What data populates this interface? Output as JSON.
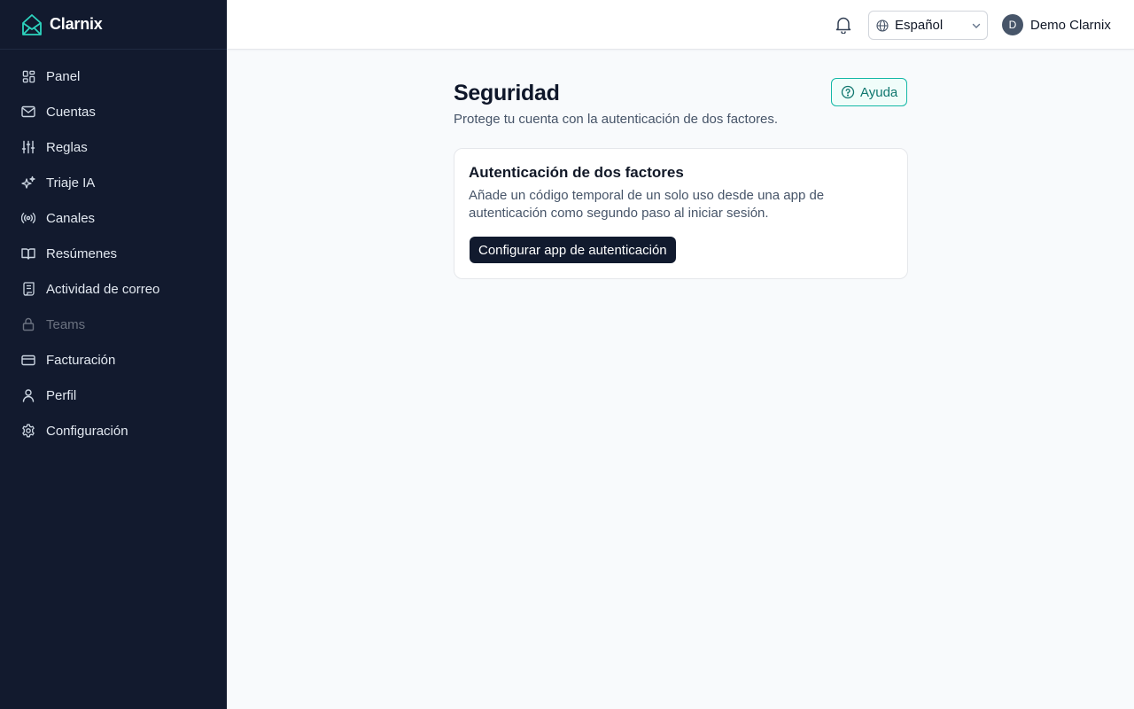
{
  "app": {
    "name": "Clarnix",
    "accent": "#14b8a6"
  },
  "sidebar": {
    "items": [
      {
        "label": "Panel",
        "icon": "dashboard-icon"
      },
      {
        "label": "Cuentas",
        "icon": "mail-icon"
      },
      {
        "label": "Reglas",
        "icon": "sliders-icon"
      },
      {
        "label": "Triaje IA",
        "icon": "sparkles-icon"
      },
      {
        "label": "Canales",
        "icon": "radio-icon"
      },
      {
        "label": "Resúmenes",
        "icon": "book-icon"
      },
      {
        "label": "Actividad de correo",
        "icon": "scroll-icon"
      },
      {
        "label": "Teams",
        "icon": "lock-icon",
        "disabled": true
      },
      {
        "label": "Facturación",
        "icon": "credit-card-icon"
      },
      {
        "label": "Perfil",
        "icon": "user-icon"
      },
      {
        "label": "Configuración",
        "icon": "gear-icon"
      }
    ]
  },
  "header": {
    "language": "Español",
    "user": {
      "initial": "D",
      "name": "Demo Clarnix"
    }
  },
  "page": {
    "title": "Seguridad",
    "subtitle": "Protege tu cuenta con la autenticación de dos factores.",
    "help_label": "Ayuda"
  },
  "card": {
    "title": "Autenticación de dos factores",
    "description": "Añade un código temporal de un solo uso desde una app de autenticación como segundo paso al iniciar sesión.",
    "button_label": "Configurar app de autenticación"
  }
}
